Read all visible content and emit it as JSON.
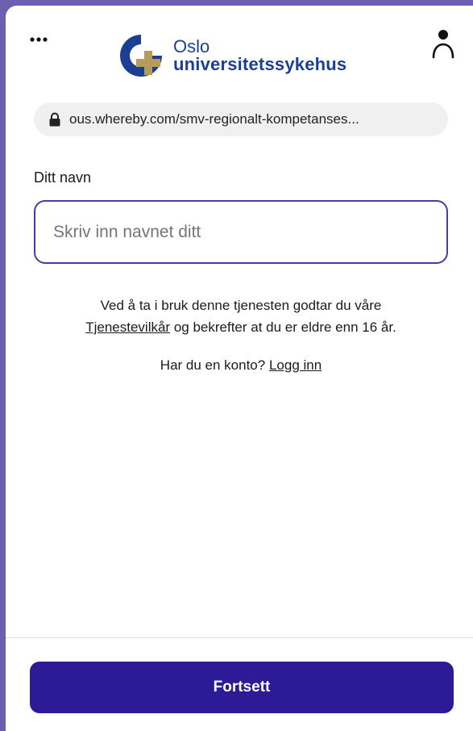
{
  "header": {
    "more_icon": "more-horizontal-icon",
    "profile_icon": "person-icon",
    "logo": {
      "line1": "Oslo",
      "line2": "universitetssykehus",
      "brand_blue": "#1c3f94",
      "brand_gold": "#b79b5c"
    }
  },
  "urlbar": {
    "icon": "lock-icon",
    "text": "ous.whereby.com/smv-regionalt-kompetanses..."
  },
  "form": {
    "name_label": "Ditt navn",
    "name_placeholder": "Skriv inn navnet ditt",
    "name_value": ""
  },
  "terms": {
    "prefix": "Ved å ta i bruk denne tjenesten godtar du våre",
    "link": "Tjenestevilkår",
    "suffix": " og bekrefter at du er eldre enn 16 år."
  },
  "login": {
    "prompt": "Har du en konto? ",
    "link": "Logg inn"
  },
  "footer": {
    "continue_label": "Fortsett",
    "accent": "#2d1a96"
  }
}
